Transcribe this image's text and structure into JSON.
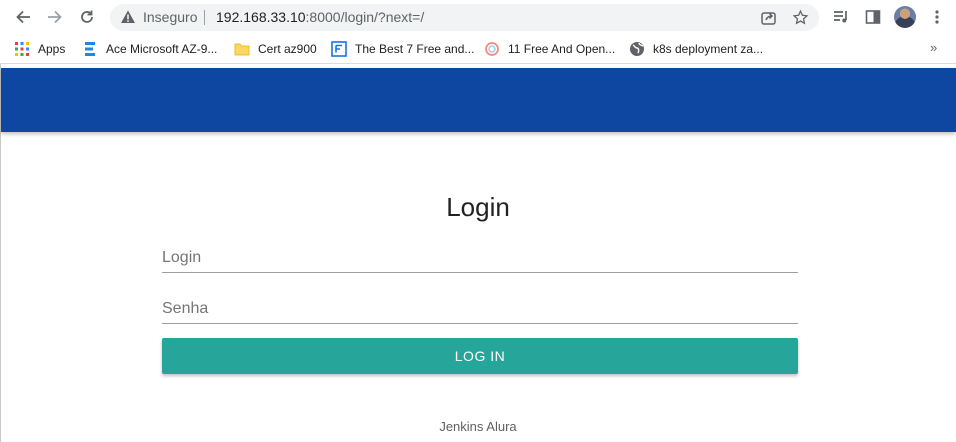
{
  "browser": {
    "back_icon": "arrow-left-icon",
    "forward_icon": "arrow-right-icon",
    "reload_icon": "reload-icon",
    "security_label": "Inseguro",
    "url_host": "192.168.33.10",
    "url_rest": ":8000/login/?next=/",
    "share_icon": "share-icon",
    "star_icon": "star-icon",
    "media_icon": "media-controls-icon",
    "sidepanel_icon": "side-panel-icon",
    "menu_icon": "kebab-menu-icon"
  },
  "bookmarks": {
    "items": [
      {
        "label": "Apps",
        "icon": "apps-grid-icon"
      },
      {
        "label": "Ace Microsoft AZ-9...",
        "icon": "bars-icon"
      },
      {
        "label": "Cert az900",
        "icon": "folder-icon"
      },
      {
        "label": "The Best 7 Free and...",
        "icon": "site-icon"
      },
      {
        "label": "11 Free And Open...",
        "icon": "swirl-icon"
      },
      {
        "label": "k8s deployment za...",
        "icon": "globe-icon"
      }
    ],
    "more_label": "»"
  },
  "page": {
    "header_color": "#0d47a1",
    "title": "Login",
    "login_placeholder": "Login",
    "password_placeholder": "Senha",
    "login_button": "LOG IN",
    "button_color": "#26a69a",
    "footer": "Jenkins Alura"
  }
}
